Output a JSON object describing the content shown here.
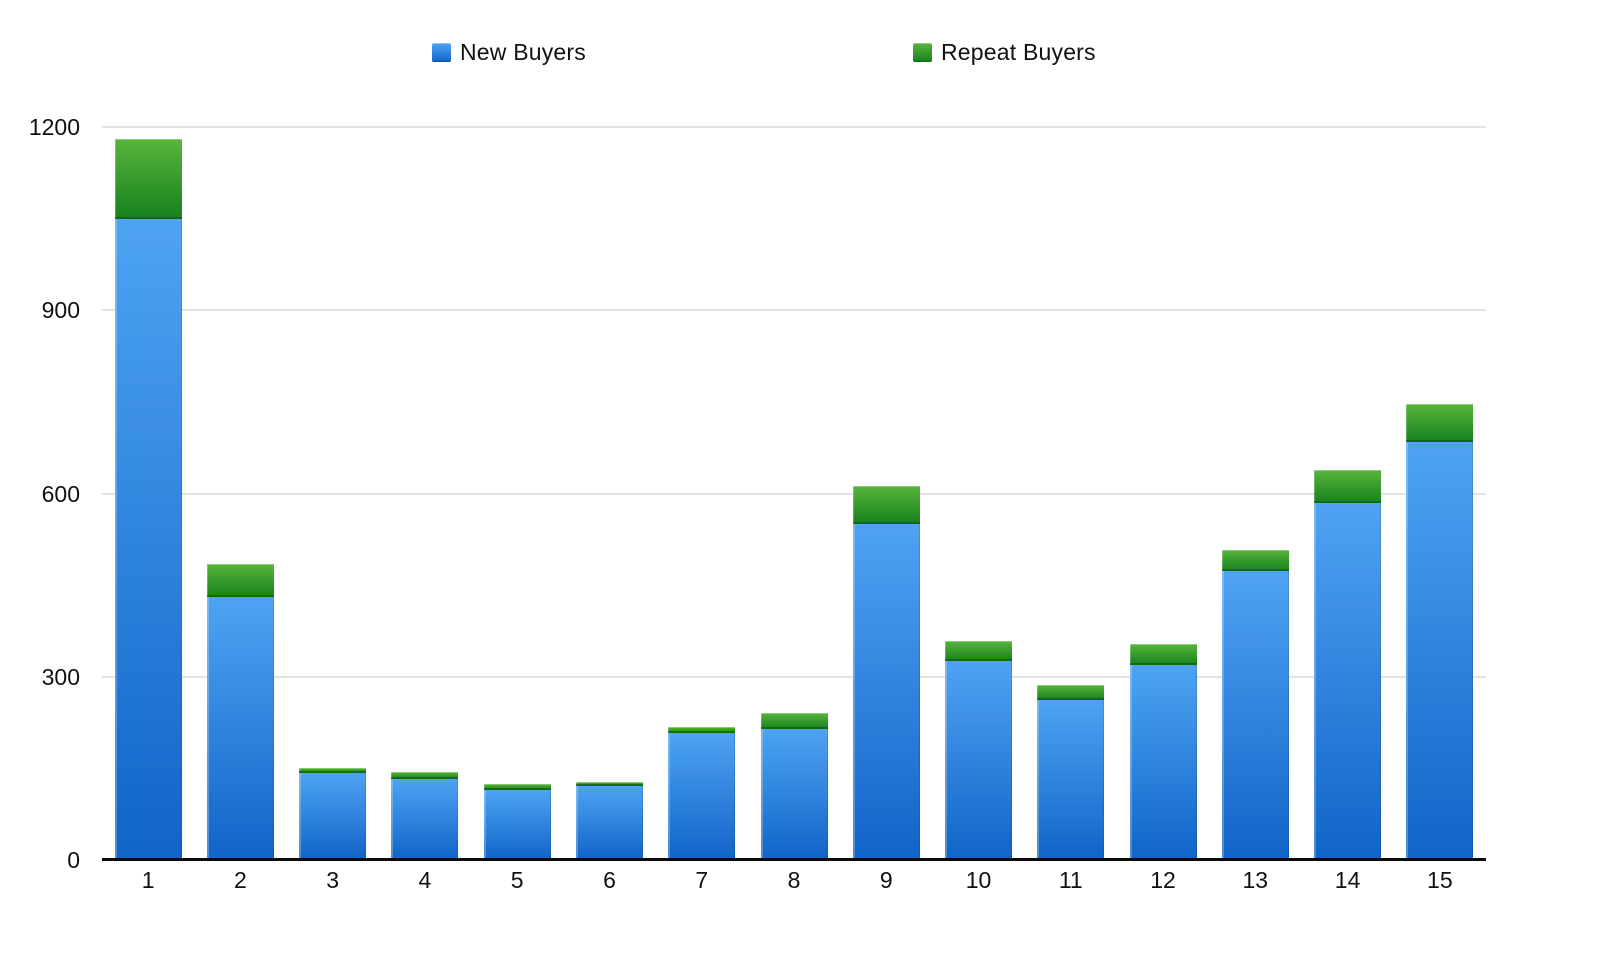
{
  "legend": {
    "items": [
      {
        "label": "New Buyers"
      },
      {
        "label": "Repeat Buyers"
      }
    ]
  },
  "chart_data": {
    "type": "bar",
    "stacked": true,
    "title": "",
    "xlabel": "",
    "ylabel": "",
    "categories": [
      "1",
      "2",
      "3",
      "4",
      "5",
      "6",
      "7",
      "8",
      "9",
      "10",
      "11",
      "12",
      "13",
      "14",
      "15"
    ],
    "series": [
      {
        "name": "New Buyers",
        "color_top": "#4FA3F2",
        "color_bottom": "#1164C8",
        "values": [
          1050,
          430,
          142,
          133,
          115,
          121,
          208,
          215,
          550,
          325,
          262,
          320,
          473,
          585,
          685
        ]
      },
      {
        "name": "Repeat Buyers",
        "color_top": "#58B53C",
        "color_bottom": "#16811D",
        "values": [
          130,
          55,
          8,
          11,
          10,
          7,
          10,
          25,
          62,
          33,
          25,
          34,
          35,
          54,
          62
        ]
      }
    ],
    "ylim": [
      0,
      1200
    ],
    "yticks": [
      0,
      300,
      600,
      900,
      1200
    ],
    "grid": true,
    "legend_position": "top"
  },
  "colors": {
    "background": "#ffffff",
    "gridline": "#e3e3e3",
    "axis": "#0a0a0a",
    "text": "#111111"
  }
}
